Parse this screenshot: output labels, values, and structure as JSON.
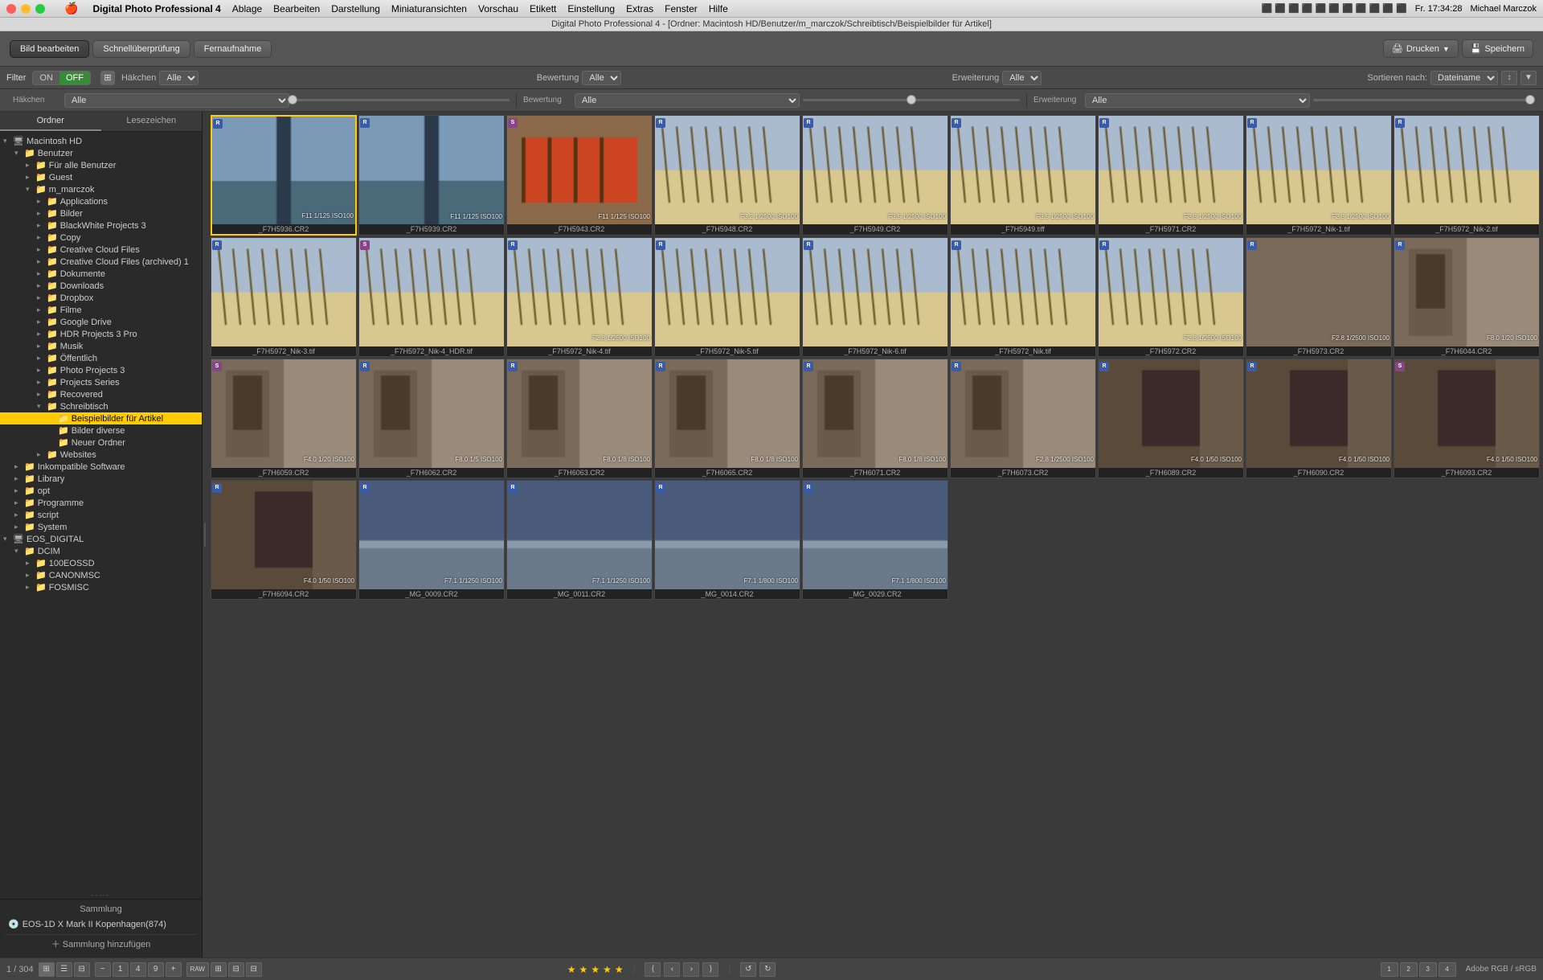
{
  "app": {
    "name": "Digital Photo Professional 4",
    "title_bar": "Digital Photo Professional 4 - [Ordner: Macintosh HD/Benutzer/m_marczok/Schreibtisch/Beispielbilder für Artikel]"
  },
  "menubar": {
    "apple": "🍎",
    "app_name": "Digital Photo Professional 4",
    "items": [
      "Ablage",
      "Bearbeiten",
      "Darstellung",
      "Miniaturansichten",
      "Vorschau",
      "Etikett",
      "Einstellung",
      "Extras",
      "Fenster",
      "Hilfe"
    ],
    "time": "Fr. 17:34:28",
    "user": "Michael Marczok"
  },
  "toolbar": {
    "bild_bearbeiten": "Bild bearbeiten",
    "schnellueberpruefung": "Schnellüberprüfung",
    "fernaufnahme": "Fernaufnahme",
    "drucken": "Drucken",
    "speichern": "Speichern"
  },
  "filter": {
    "label": "Filter",
    "on": "ON",
    "off": "OFF",
    "sort_label": "Sortieren nach:",
    "sort_value": "Dateiname",
    "haken_label": "Häkchen",
    "haken_value": "Alle",
    "bewertung_label": "Bewertung",
    "bewertung_value": "Alle",
    "erweiterung_label": "Erweiterung",
    "erweiterung_value": "Alle"
  },
  "sidebar": {
    "ordner_tab": "Ordner",
    "lesezeichen_tab": "Lesezeichen",
    "tree": [
      {
        "label": "Macintosh HD",
        "level": 0,
        "expanded": true,
        "type": "hd"
      },
      {
        "label": "Benutzer",
        "level": 1,
        "expanded": true,
        "type": "folder"
      },
      {
        "label": "Für alle Benutzer",
        "level": 2,
        "expanded": false,
        "type": "folder"
      },
      {
        "label": "Guest",
        "level": 2,
        "expanded": false,
        "type": "folder"
      },
      {
        "label": "m_marczok",
        "level": 2,
        "expanded": true,
        "type": "folder"
      },
      {
        "label": "Applications",
        "level": 3,
        "expanded": false,
        "type": "folder"
      },
      {
        "label": "Bilder",
        "level": 3,
        "expanded": false,
        "type": "folder"
      },
      {
        "label": "BlackWhite Projects 3",
        "level": 3,
        "expanded": false,
        "type": "folder"
      },
      {
        "label": "Copy",
        "level": 3,
        "expanded": false,
        "type": "folder"
      },
      {
        "label": "Creative Cloud Files",
        "level": 3,
        "expanded": false,
        "type": "folder"
      },
      {
        "label": "Creative Cloud Files (archived) 1",
        "level": 3,
        "expanded": false,
        "type": "folder"
      },
      {
        "label": "Dokumente",
        "level": 3,
        "expanded": false,
        "type": "folder"
      },
      {
        "label": "Downloads",
        "level": 3,
        "expanded": false,
        "type": "folder"
      },
      {
        "label": "Dropbox",
        "level": 3,
        "expanded": false,
        "type": "folder"
      },
      {
        "label": "Filme",
        "level": 3,
        "expanded": false,
        "type": "folder"
      },
      {
        "label": "Google Drive",
        "level": 3,
        "expanded": false,
        "type": "folder"
      },
      {
        "label": "HDR Projects 3 Pro",
        "level": 3,
        "expanded": false,
        "type": "folder"
      },
      {
        "label": "Musik",
        "level": 3,
        "expanded": false,
        "type": "folder"
      },
      {
        "label": "Öffentlich",
        "level": 3,
        "expanded": false,
        "type": "folder"
      },
      {
        "label": "Photo Projects 3",
        "level": 3,
        "expanded": false,
        "type": "folder"
      },
      {
        "label": "Projects Series",
        "level": 3,
        "expanded": false,
        "type": "folder"
      },
      {
        "label": "Recovered",
        "level": 3,
        "expanded": false,
        "type": "folder"
      },
      {
        "label": "Schreibtisch",
        "level": 3,
        "expanded": true,
        "type": "folder"
      },
      {
        "label": "Beispielbilder für Artikel",
        "level": 4,
        "expanded": false,
        "type": "folder",
        "selected": true
      },
      {
        "label": "Bilder diverse",
        "level": 4,
        "expanded": false,
        "type": "folder"
      },
      {
        "label": "Neuer Ordner",
        "level": 4,
        "expanded": false,
        "type": "folder"
      },
      {
        "label": "Websites",
        "level": 3,
        "expanded": false,
        "type": "folder"
      },
      {
        "label": "Inkompatible Software",
        "level": 1,
        "expanded": false,
        "type": "folder"
      },
      {
        "label": "Library",
        "level": 1,
        "expanded": false,
        "type": "folder"
      },
      {
        "label": "opt",
        "level": 1,
        "expanded": false,
        "type": "folder"
      },
      {
        "label": "Programme",
        "level": 1,
        "expanded": false,
        "type": "folder"
      },
      {
        "label": "script",
        "level": 1,
        "expanded": false,
        "type": "folder"
      },
      {
        "label": "System",
        "level": 1,
        "expanded": false,
        "type": "folder"
      },
      {
        "label": "EOS_DIGITAL",
        "level": 0,
        "expanded": true,
        "type": "hd"
      },
      {
        "label": "DCIM",
        "level": 1,
        "expanded": true,
        "type": "folder"
      },
      {
        "label": "100EOSSD",
        "level": 2,
        "expanded": false,
        "type": "folder"
      },
      {
        "label": "CANONMSC",
        "level": 2,
        "expanded": false,
        "type": "folder"
      },
      {
        "label": "FOSMISC",
        "level": 2,
        "expanded": false,
        "type": "folder"
      }
    ],
    "dots_more": ".....",
    "sammlung_label": "Sammlung",
    "collection_item": "EOS-1D X Mark II Kopenhagen(874)",
    "add_collection": "＋ Sammlung hinzufügen"
  },
  "photos": [
    {
      "name": "_F7H5936.CR2",
      "badge": "R",
      "exif": "F11\n1/125\nISO100",
      "selected": true,
      "color": "#4a6a8a"
    },
    {
      "name": "_F7H5939.CR2",
      "badge": "R",
      "exif": "F11\n1/125\nISO100",
      "color": "#5a7a9a"
    },
    {
      "name": "_F7H5943.CR2",
      "badge": "S",
      "exif": "F11\n1/125\nISO100",
      "color": "#7a6a4a"
    },
    {
      "name": "_F7H5948.CR2",
      "badge": "R",
      "exif": "F3.2\n1/2500\nISO100",
      "color": "#8a7a5a"
    },
    {
      "name": "_F7H5949.CR2",
      "badge": "R",
      "exif": "F3.5\n1/2500\nISO100",
      "color": "#9a8a6a"
    },
    {
      "name": "_F7H5949.tiff",
      "badge": "R",
      "exif": "F3.5\n1/2500\nISO100",
      "color": "#8a7a6a"
    },
    {
      "name": "_F7H5971.CR2",
      "badge": "R",
      "exif": "F2.8\n1/2500\nISO100",
      "color": "#9a9a7a"
    },
    {
      "name": "_F7H5972_Nik-1.tif",
      "badge": "R",
      "exif": "F2.8\n1/2500\nISO100",
      "color": "#8a9a8a"
    },
    {
      "name": "_F7H5972_Nik-2.tif",
      "badge": "R",
      "exif": "",
      "color": "#5a5a8a"
    },
    {
      "name": "_F7H5972_Nik-3.tif",
      "badge": "R",
      "exif": "",
      "color": "#7a7a6a"
    },
    {
      "name": "_F7H5972_Nik-4_HDR.tif",
      "badge": "S",
      "exif": "",
      "color": "#8a6a4a"
    },
    {
      "name": "_F7H5972_Nik-4.tif",
      "badge": "R",
      "exif": "F2.8\n1/2500\nISO100",
      "color": "#6a8a6a"
    },
    {
      "name": "_F7H5972_Nik-5.tif",
      "badge": "R",
      "exif": "",
      "color": "#7a8a7a"
    },
    {
      "name": "_F7H5972_Nik-6.tif",
      "badge": "R",
      "exif": "",
      "color": "#6a7a6a"
    },
    {
      "name": "_F7H5972_Nik.tif",
      "badge": "R",
      "exif": "",
      "color": "#3a3a3a"
    },
    {
      "name": "_F7H5972.CR2",
      "badge": "R",
      "exif": "F2.8\n1/2500\nISO100",
      "color": "#5a8a9a"
    },
    {
      "name": "_F7H5973.CR2",
      "badge": "R",
      "exif": "F2.8\n1/2500\nISO100",
      "color": "#7a6a5a"
    },
    {
      "name": "_F7H6044.CR2",
      "badge": "R",
      "exif": "F8.0\n1/20\nISO100",
      "color": "#6a5a4a"
    },
    {
      "name": "_F7H6059.CR2",
      "badge": "S",
      "exif": "F4.0\n1/20\nISO100",
      "color": "#5a4a3a"
    },
    {
      "name": "_F7H6062.CR2",
      "badge": "R",
      "exif": "F8.0\n1/5\nISO100",
      "color": "#6a5a4a"
    },
    {
      "name": "_F7H6063.CR2",
      "badge": "R",
      "exif": "F8.0\n1/8\nISO100",
      "color": "#7a6a5a"
    },
    {
      "name": "_F7H6065.CR2",
      "badge": "R",
      "exif": "F8.0\n1/8\nISO100",
      "color": "#8a7a6a"
    },
    {
      "name": "_F7H6071.CR2",
      "badge": "R",
      "exif": "F8.0\n1/8\nISO100",
      "color": "#9a8a7a"
    },
    {
      "name": "_F7H6073.CR2",
      "badge": "R",
      "exif": "F2.8\n1/2500\nISO100",
      "color": "#7a8a9a"
    },
    {
      "name": "_F7H6089.CR2",
      "badge": "R",
      "exif": "F4.0\n1/50\nISO100",
      "color": "#5a4a3a"
    },
    {
      "name": "_F7H6090.CR2",
      "badge": "R",
      "exif": "F4.0\n1/50\nISO100",
      "color": "#4a3a2a"
    },
    {
      "name": "_F7H6093.CR2",
      "badge": "S",
      "exif": "F4.0\n1/50\nISO100",
      "color": "#5a4a3a"
    },
    {
      "name": "_F7H6094.CR2",
      "badge": "R",
      "exif": "F4.0\n1/50\nISO100",
      "color": "#4a3a2a"
    },
    {
      "name": "_MG_0009.CR2",
      "badge": "R",
      "exif": "F7.1\n1/1250\nISO100",
      "color": "#5a6a7a"
    },
    {
      "name": "_MG_0011.CR2",
      "badge": "R",
      "exif": "F7.1\n1/1250\nISO100",
      "color": "#4a5a6a"
    },
    {
      "name": "_MG_0014.CR2",
      "badge": "R",
      "exif": "F7.1\n1/800\nISO100",
      "color": "#5a6a8a"
    },
    {
      "name": "_MG_0029.CR2",
      "badge": "R",
      "exif": "F7.1\n1/800\nISO100",
      "color": "#4a5a7a"
    }
  ],
  "statusbar": {
    "count": "1 / 304",
    "add_collection": "＋ Sammlung hinzufügen",
    "color_profile": "Adobe RGB / sRGB",
    "stars": [
      "1",
      "2",
      "3",
      "4",
      "5"
    ]
  }
}
